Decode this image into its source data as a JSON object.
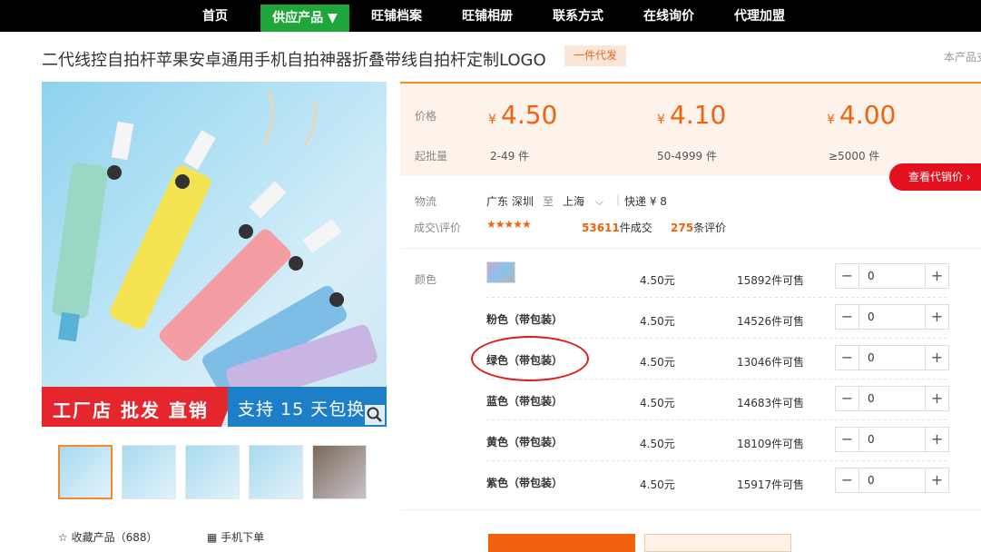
{
  "nav": [
    {
      "label": "首页"
    },
    {
      "label": "供应产品 ▼"
    },
    {
      "label": "旺铺档案"
    },
    {
      "label": "旺铺相册"
    },
    {
      "label": "联系方式"
    },
    {
      "label": "在线询价"
    },
    {
      "label": "代理加盟"
    }
  ],
  "product": {
    "title": "二代线控自拍杆苹果安卓通用手机自拍神器折叠带线自拍杆定制LOGO",
    "badge": "一件代发",
    "side_note": "本产品支"
  },
  "gallery": {
    "banner_left": "工厂店 批发 直销",
    "banner_right": "支持 15 天包换",
    "fav_label": "收藏产品（688）",
    "mobile_label": "手机下单"
  },
  "pricing": {
    "price_label": "价格",
    "moq_label": "起批量",
    "currency": "¥",
    "tiers": [
      {
        "price": "4.50",
        "range": "2-49 件"
      },
      {
        "price": "4.10",
        "range": "50-4999 件"
      },
      {
        "price": "4.00",
        "range": "≥5000 件"
      }
    ],
    "agent_button": "查看代销价 ›"
  },
  "logistics": {
    "label": "物流",
    "from": "广东 深圳",
    "to_word": "至",
    "to": "上海",
    "express": "快递 ¥ 8",
    "rating_label": "成交\\评价",
    "stars": "★★★★★",
    "deals": "53611",
    "deals_unit": "件成交",
    "reviews": "275",
    "reviews_unit": "条评价"
  },
  "colors": {
    "label": "颜色",
    "rows": [
      {
        "name": "",
        "price": "4.50元",
        "stock": "15892件可售",
        "qty": "0"
      },
      {
        "name": "粉色（带包装）",
        "price": "4.50元",
        "stock": "14526件可售",
        "qty": "0"
      },
      {
        "name": "绿色（带包装）",
        "price": "4.50元",
        "stock": "13046件可售",
        "qty": "0"
      },
      {
        "name": "蓝色（带包装）",
        "price": "4.50元",
        "stock": "14683件可售",
        "qty": "0"
      },
      {
        "name": "黄色（带包装）",
        "price": "4.50元",
        "stock": "18109件可售",
        "qty": "0"
      },
      {
        "name": "紫色（带包装）",
        "price": "4.50元",
        "stock": "15917件可售",
        "qty": "0"
      }
    ]
  },
  "style_colors": {
    "accent": "#f0620d",
    "nav_active": "#1ea63a",
    "annotation_circle": "#e01b1b"
  }
}
